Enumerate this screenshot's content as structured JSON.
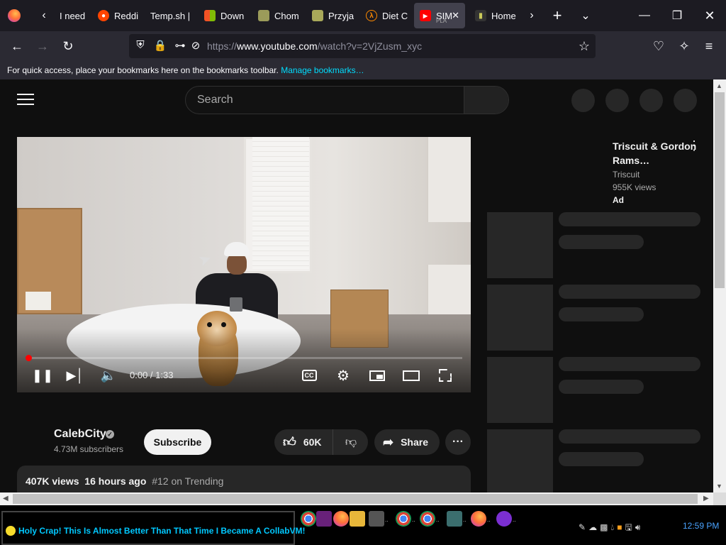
{
  "browser": {
    "tabs": [
      {
        "label": "I need",
        "favicon": "generic-icon",
        "active": false
      },
      {
        "label": "Reddi",
        "favicon": "reddit-icon",
        "active": false
      },
      {
        "label": "Temp.sh |",
        "favicon": "none",
        "active": false
      },
      {
        "label": "Down",
        "favicon": "windows-icon",
        "active": false
      },
      {
        "label": "Chom",
        "favicon": "chomp-icon",
        "active": false
      },
      {
        "label": "Przyja",
        "favicon": "przyja-icon",
        "active": false
      },
      {
        "label": "Diet C",
        "favicon": "half-life-icon",
        "active": false
      },
      {
        "label": "SIM",
        "sublabel": "PLA",
        "favicon": "youtube-icon",
        "active": true
      },
      {
        "label": "Home",
        "favicon": "home-shield-icon",
        "active": false
      }
    ],
    "url_scheme": "https://",
    "url_host": "www.youtube.com",
    "url_path": "/watch?v=2VjZusm_xyc",
    "bookmarks_text": "For quick access, place your bookmarks here on the bookmarks toolbar.",
    "bookmarks_link": "Manage bookmarks…"
  },
  "youtube": {
    "search_placeholder": "Search",
    "player": {
      "time": "0:00 / 1:33",
      "progress": 0.005,
      "cc_label": "CC"
    },
    "ad": {
      "title": "Triscuit & Gordon Rams…",
      "sponsor": "Triscuit",
      "views": "955K views",
      "label": "Ad"
    },
    "channel": {
      "name": "CalebCity",
      "subscribers": "4.73M subscribers",
      "subscribe_label": "Subscribe",
      "likes": "60K",
      "share_label": "Share"
    },
    "description": {
      "views": "407K views",
      "age": "16 hours ago",
      "trending": "#12 on Trending"
    },
    "accent": "#ff0000"
  },
  "taskbar": {
    "ticker": "Holy Crap! This Is Almost Better Than That Time I Became A CollabVM!",
    "clock": "12:59 PM"
  }
}
